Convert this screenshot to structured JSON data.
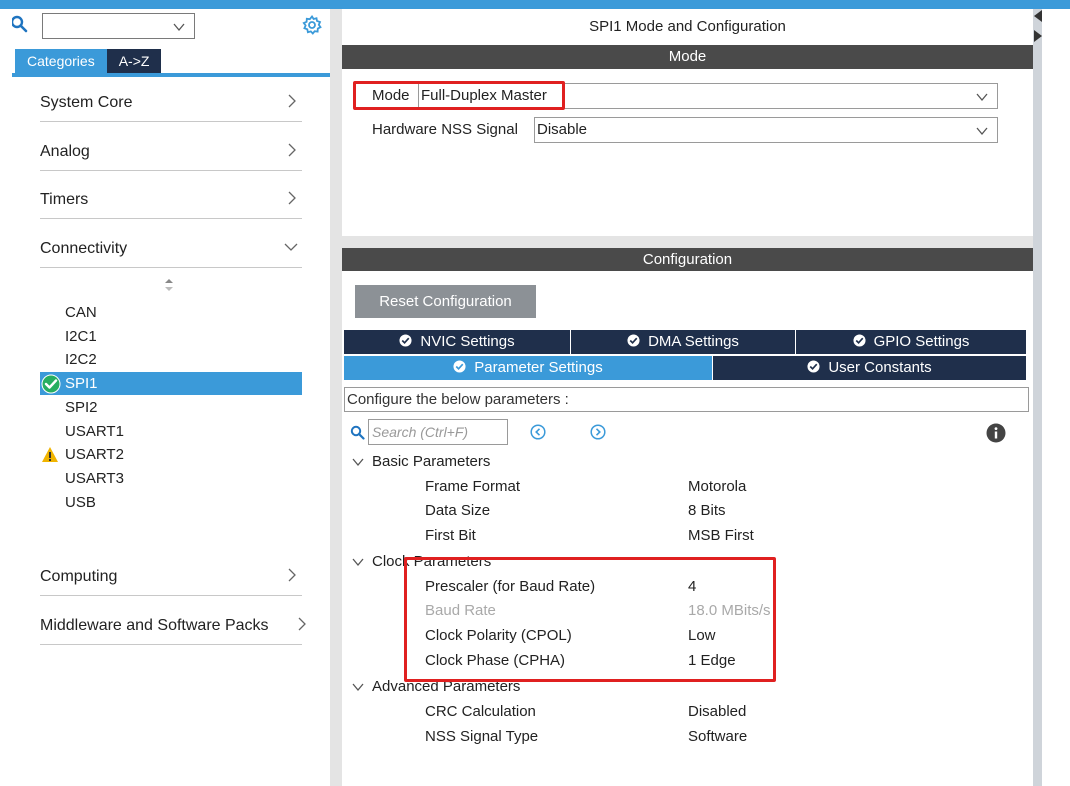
{
  "sidebar": {
    "search": {
      "value": ""
    },
    "tabs": [
      {
        "label": "Categories",
        "active": true
      },
      {
        "label": "A->Z",
        "active": false
      }
    ],
    "categories": [
      {
        "label": "System Core",
        "expanded": false
      },
      {
        "label": "Analog",
        "expanded": false
      },
      {
        "label": "Timers",
        "expanded": false
      },
      {
        "label": "Connectivity",
        "expanded": true
      },
      {
        "label": "Computing",
        "expanded": false
      },
      {
        "label": "Middleware and Software Packs",
        "expanded": false
      }
    ],
    "peripherals": [
      {
        "name": "CAN",
        "status": "none"
      },
      {
        "name": "I2C1",
        "status": "none"
      },
      {
        "name": "I2C2",
        "status": "none"
      },
      {
        "name": "SPI1",
        "status": "ok",
        "selected": true
      },
      {
        "name": "SPI2",
        "status": "none"
      },
      {
        "name": "USART1",
        "status": "none"
      },
      {
        "name": "USART2",
        "status": "warning"
      },
      {
        "name": "USART3",
        "status": "none"
      },
      {
        "name": "USB",
        "status": "none"
      }
    ]
  },
  "main": {
    "title": "SPI1 Mode and Configuration",
    "mode_header": "Mode",
    "mode_fields": [
      {
        "label": "Mode",
        "value": "Full-Duplex Master"
      },
      {
        "label": "Hardware NSS Signal",
        "value": "Disable"
      }
    ],
    "config_header": "Configuration",
    "reset_label": "Reset Configuration",
    "tabs_row1": [
      "NVIC Settings",
      "DMA Settings",
      "GPIO Settings"
    ],
    "tabs_row2": [
      "Parameter Settings",
      "User Constants"
    ],
    "active_tab": "Parameter Settings",
    "configure_note": "Configure the below parameters :",
    "param_search_placeholder": "Search (Ctrl+F)",
    "groups": [
      {
        "name": "Basic Parameters",
        "params": [
          {
            "name": "Frame Format",
            "value": "Motorola",
            "disabled": false
          },
          {
            "name": "Data Size",
            "value": "8 Bits",
            "disabled": false
          },
          {
            "name": "First Bit",
            "value": "MSB First",
            "disabled": false
          }
        ]
      },
      {
        "name": "Clock Parameters",
        "params": [
          {
            "name": "Prescaler (for Baud Rate)",
            "value": "4",
            "disabled": false
          },
          {
            "name": "Baud Rate",
            "value": "18.0 MBits/s",
            "disabled": true
          },
          {
            "name": "Clock Polarity (CPOL)",
            "value": "Low",
            "disabled": false
          },
          {
            "name": "Clock Phase (CPHA)",
            "value": "1 Edge",
            "disabled": false
          }
        ]
      },
      {
        "name": "Advanced Parameters",
        "params": [
          {
            "name": "CRC Calculation",
            "value": "Disabled",
            "disabled": false
          },
          {
            "name": "NSS Signal Type",
            "value": "Software",
            "disabled": false
          }
        ]
      }
    ]
  },
  "colors": {
    "accent": "#3b9ad9",
    "tab_dark": "#1f2f4b",
    "header_bar": "#4a4a4a",
    "highlight_box": "#e02020",
    "ok": "#27ae60",
    "warning": "#f0b400"
  }
}
